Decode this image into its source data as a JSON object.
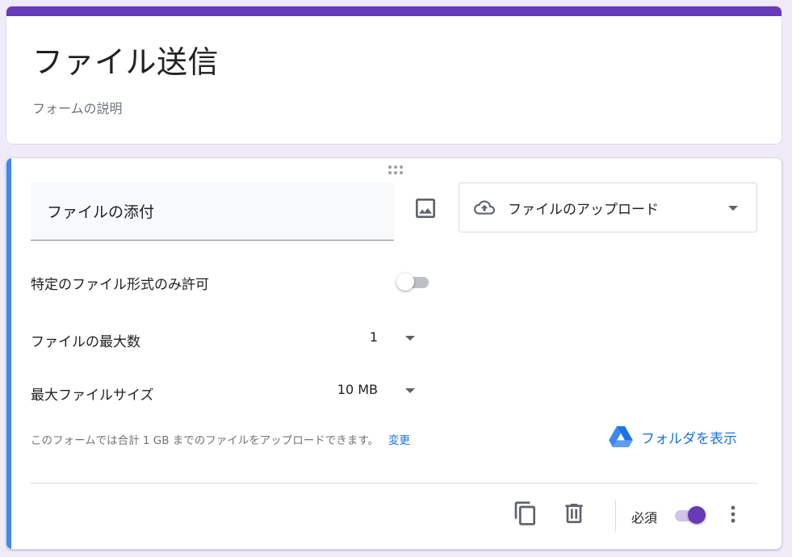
{
  "form": {
    "title": "ファイル送信",
    "description": "フォームの説明",
    "accent_color": "#673ab7"
  },
  "question": {
    "title": "ファイルの添付",
    "type_label": "ファイルのアップロード",
    "active_bar_color": "#4285f4",
    "settings": {
      "specific_types_label": "特定のファイル形式のみ許可",
      "specific_types_enabled": false,
      "max_files_label": "ファイルの最大数",
      "max_files_value": "1",
      "max_size_label": "最大ファイルサイズ",
      "max_size_value": "10 MB"
    },
    "quota_note": "このフォームでは合計 1 GB までのファイルをアップロードできます。",
    "change_link": "変更",
    "view_folder_label": "フォルダを表示",
    "footer": {
      "required_label": "必須",
      "required_enabled": true
    },
    "icons": [
      "drag-handle-icon",
      "image-icon",
      "cloud-upload-icon",
      "chevron-down-icon",
      "google-drive-icon",
      "copy-icon",
      "delete-icon",
      "more-vert-icon"
    ]
  }
}
